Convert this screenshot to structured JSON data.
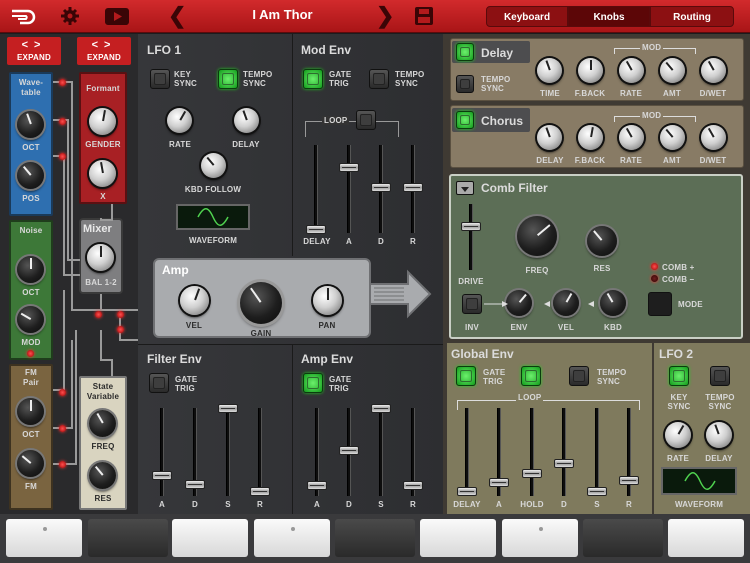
{
  "header": {
    "title": "I Am Thor",
    "tabs": [
      {
        "label": "Keyboard",
        "active": false
      },
      {
        "label": "Knobs",
        "active": true
      },
      {
        "label": "Routing",
        "active": false
      }
    ]
  },
  "osc": {
    "expand_left": "EXPAND",
    "expand_right": "EXPAND",
    "wavetable": {
      "title": "Wave-\ntable",
      "oct": "OCT",
      "pos": "POS"
    },
    "noise": {
      "title": "Noise",
      "oct": "OCT",
      "mod": "MOD"
    },
    "fm": {
      "title": "FM\nPair",
      "oct": "OCT",
      "fm": "FM"
    },
    "formant": {
      "title": "Formant",
      "gender": "GENDER",
      "x": "X"
    },
    "state_variable": {
      "title": "State\nVariable",
      "freq": "FREQ",
      "res": "RES"
    },
    "mixer": {
      "title": "Mixer",
      "bal": "BAL 1-2"
    }
  },
  "lfo1": {
    "title": "LFO 1",
    "key_sync": "KEY\nSYNC",
    "tempo_sync": "TEMPO\nSYNC",
    "rate": "RATE",
    "delay": "DELAY",
    "kbd_follow": "KBD FOLLOW",
    "waveform": "WAVEFORM"
  },
  "mod_env": {
    "title": "Mod Env",
    "gate_trig": "GATE\nTRIG",
    "tempo_sync": "TEMPO\nSYNC",
    "loop": "LOOP",
    "faders": [
      "DELAY",
      "A",
      "D",
      "R"
    ]
  },
  "amp": {
    "title": "Amp",
    "vel": "VEL",
    "gain": "GAIN",
    "pan": "PAN"
  },
  "filter_env": {
    "title": "Filter Env",
    "gate_trig": "GATE\nTRIG",
    "faders": [
      "A",
      "D",
      "S",
      "R"
    ]
  },
  "amp_env": {
    "title": "Amp Env",
    "gate_trig": "GATE\nTRIG",
    "faders": [
      "A",
      "D",
      "S",
      "R"
    ]
  },
  "delay": {
    "title": "Delay",
    "tempo_sync": "TEMPO\nSYNC",
    "mod": "MOD",
    "knobs": [
      "TIME",
      "F.BACK",
      "RATE",
      "AMT",
      "D/WET"
    ]
  },
  "chorus": {
    "title": "Chorus",
    "mod": "MOD",
    "knobs": [
      "DELAY",
      "F.BACK",
      "RATE",
      "AMT",
      "D/WET"
    ]
  },
  "comb": {
    "title": "Comb Filter",
    "drive": "DRIVE",
    "freq": "FREQ",
    "res": "RES",
    "comb_plus": "COMB +",
    "comb_minus": "COMB –",
    "inv": "INV",
    "env": "ENV",
    "vel": "VEL",
    "kbd": "KBD",
    "mode": "MODE"
  },
  "global_env": {
    "title": "Global Env",
    "gate_trig": "GATE\nTRIG",
    "tempo_sync": "TEMPO\nSYNC",
    "loop": "LOOP",
    "faders": [
      "DELAY",
      "A",
      "HOLD",
      "D",
      "S",
      "R"
    ]
  },
  "lfo2": {
    "title": "LFO 2",
    "key_sync": "KEY\nSYNC",
    "tempo_sync": "TEMPO\nSYNC",
    "rate": "RATE",
    "delay": "DELAY",
    "waveform": "WAVEFORM"
  }
}
